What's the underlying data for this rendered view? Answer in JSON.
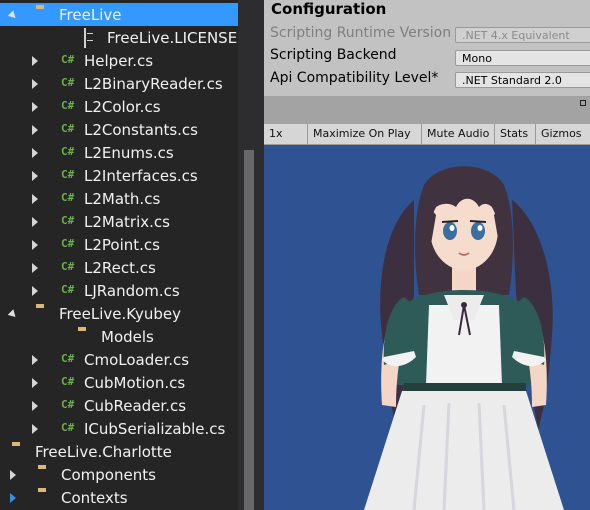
{
  "explorer": {
    "items": [
      {
        "label": "FreeLive",
        "kind": "folder",
        "arrow": "expanded",
        "selected": true
      },
      {
        "label": "FreeLive.LICENSE.txt",
        "kind": "doc",
        "arrow": "none"
      },
      {
        "label": "Helper.cs",
        "kind": "cs",
        "arrow": "collapsed"
      },
      {
        "label": "L2BinaryReader.cs",
        "kind": "cs",
        "arrow": "collapsed"
      },
      {
        "label": "L2Color.cs",
        "kind": "cs",
        "arrow": "collapsed"
      },
      {
        "label": "L2Constants.cs",
        "kind": "cs",
        "arrow": "collapsed"
      },
      {
        "label": "L2Enums.cs",
        "kind": "cs",
        "arrow": "collapsed"
      },
      {
        "label": "L2Interfaces.cs",
        "kind": "cs",
        "arrow": "collapsed"
      },
      {
        "label": "L2Math.cs",
        "kind": "cs",
        "arrow": "collapsed"
      },
      {
        "label": "L2Matrix.cs",
        "kind": "cs",
        "arrow": "collapsed"
      },
      {
        "label": "L2Point.cs",
        "kind": "cs",
        "arrow": "collapsed"
      },
      {
        "label": "L2Rect.cs",
        "kind": "cs",
        "arrow": "collapsed"
      },
      {
        "label": "LJRandom.cs",
        "kind": "cs",
        "arrow": "collapsed"
      },
      {
        "label": "FreeLive.Kyubey",
        "kind": "folder",
        "arrow": "expanded"
      },
      {
        "label": "Models",
        "kind": "folder",
        "arrow": "none"
      },
      {
        "label": "CmoLoader.cs",
        "kind": "cs",
        "arrow": "collapsed"
      },
      {
        "label": "CubMotion.cs",
        "kind": "cs",
        "arrow": "collapsed"
      },
      {
        "label": "CubReader.cs",
        "kind": "cs",
        "arrow": "collapsed"
      },
      {
        "label": "ICubSerializable.cs",
        "kind": "cs",
        "arrow": "collapsed"
      },
      {
        "label": "FreeLive.Charlotte",
        "kind": "folder",
        "arrow": "none"
      },
      {
        "label": "Components",
        "kind": "folder",
        "arrow": "collapsed"
      },
      {
        "label": "Contexts",
        "kind": "folder",
        "arrow": "collapsed-blue"
      }
    ]
  },
  "config": {
    "title": "Configuration",
    "rows": [
      {
        "label": "Scripting Runtime Version",
        "value": ".NET 4.x Equivalent",
        "disabled": true
      },
      {
        "label": "Scripting Backend",
        "value": "Mono",
        "disabled": false
      },
      {
        "label": "Api Compatibility Level*",
        "value": ".NET Standard 2.0",
        "disabled": false
      }
    ]
  },
  "game_toolbar": {
    "scale": "1x",
    "maximize_on_play": "Maximize On Play",
    "mute_audio": "Mute Audio",
    "stats": "Stats",
    "gizmos": "Gizmos"
  },
  "colors": {
    "selection": "#3399ff",
    "game_background": "#2f5392",
    "cs_icon": "#6ab04c",
    "folder_icon": "#dcb67a"
  }
}
